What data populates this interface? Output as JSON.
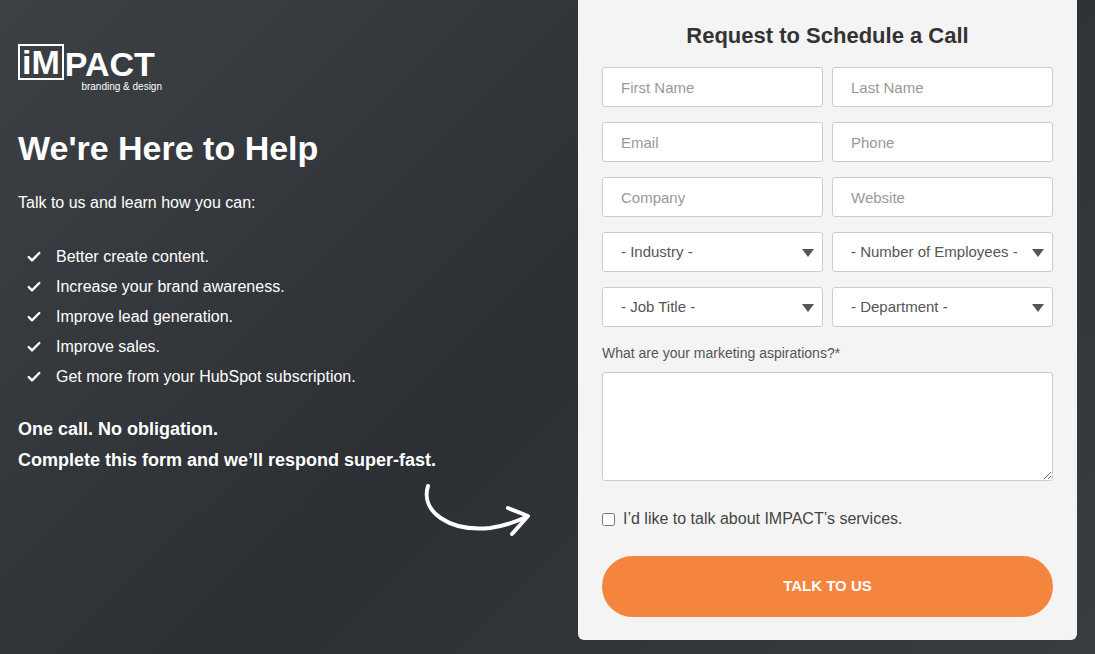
{
  "brand": {
    "logo_boxed": "iM",
    "logo_rest": "PACT",
    "tagline": "branding & design"
  },
  "hero": {
    "title": "We're Here to Help",
    "intro": "Talk to us and learn how you can:",
    "benefits": [
      "Better create content.",
      "Increase your brand awareness.",
      "Improve lead generation.",
      "Improve sales.",
      "Get more from your HubSpot subscription."
    ],
    "closing": [
      "One call. No obligation.",
      "Complete this form and we’ll respond super-fast."
    ]
  },
  "form": {
    "title": "Request to Schedule a Call",
    "fields": [
      {
        "kind": "input",
        "placeholder": "First Name"
      },
      {
        "kind": "input",
        "placeholder": "Last Name"
      },
      {
        "kind": "input",
        "placeholder": "Email"
      },
      {
        "kind": "input",
        "placeholder": "Phone"
      },
      {
        "kind": "input",
        "placeholder": "Company"
      },
      {
        "kind": "input",
        "placeholder": "Website"
      },
      {
        "kind": "select",
        "placeholder": "- Industry -"
      },
      {
        "kind": "select",
        "placeholder": "- Number of Employees -"
      },
      {
        "kind": "select",
        "placeholder": "- Job Title -"
      },
      {
        "kind": "select",
        "placeholder": "- Department -"
      }
    ],
    "textarea": {
      "label": "What are your marketing aspirations?*"
    },
    "checkbox": {
      "label": "I’d like to talk about IMPACT’s services.",
      "checked": false
    },
    "submit": "TALK TO US"
  }
}
